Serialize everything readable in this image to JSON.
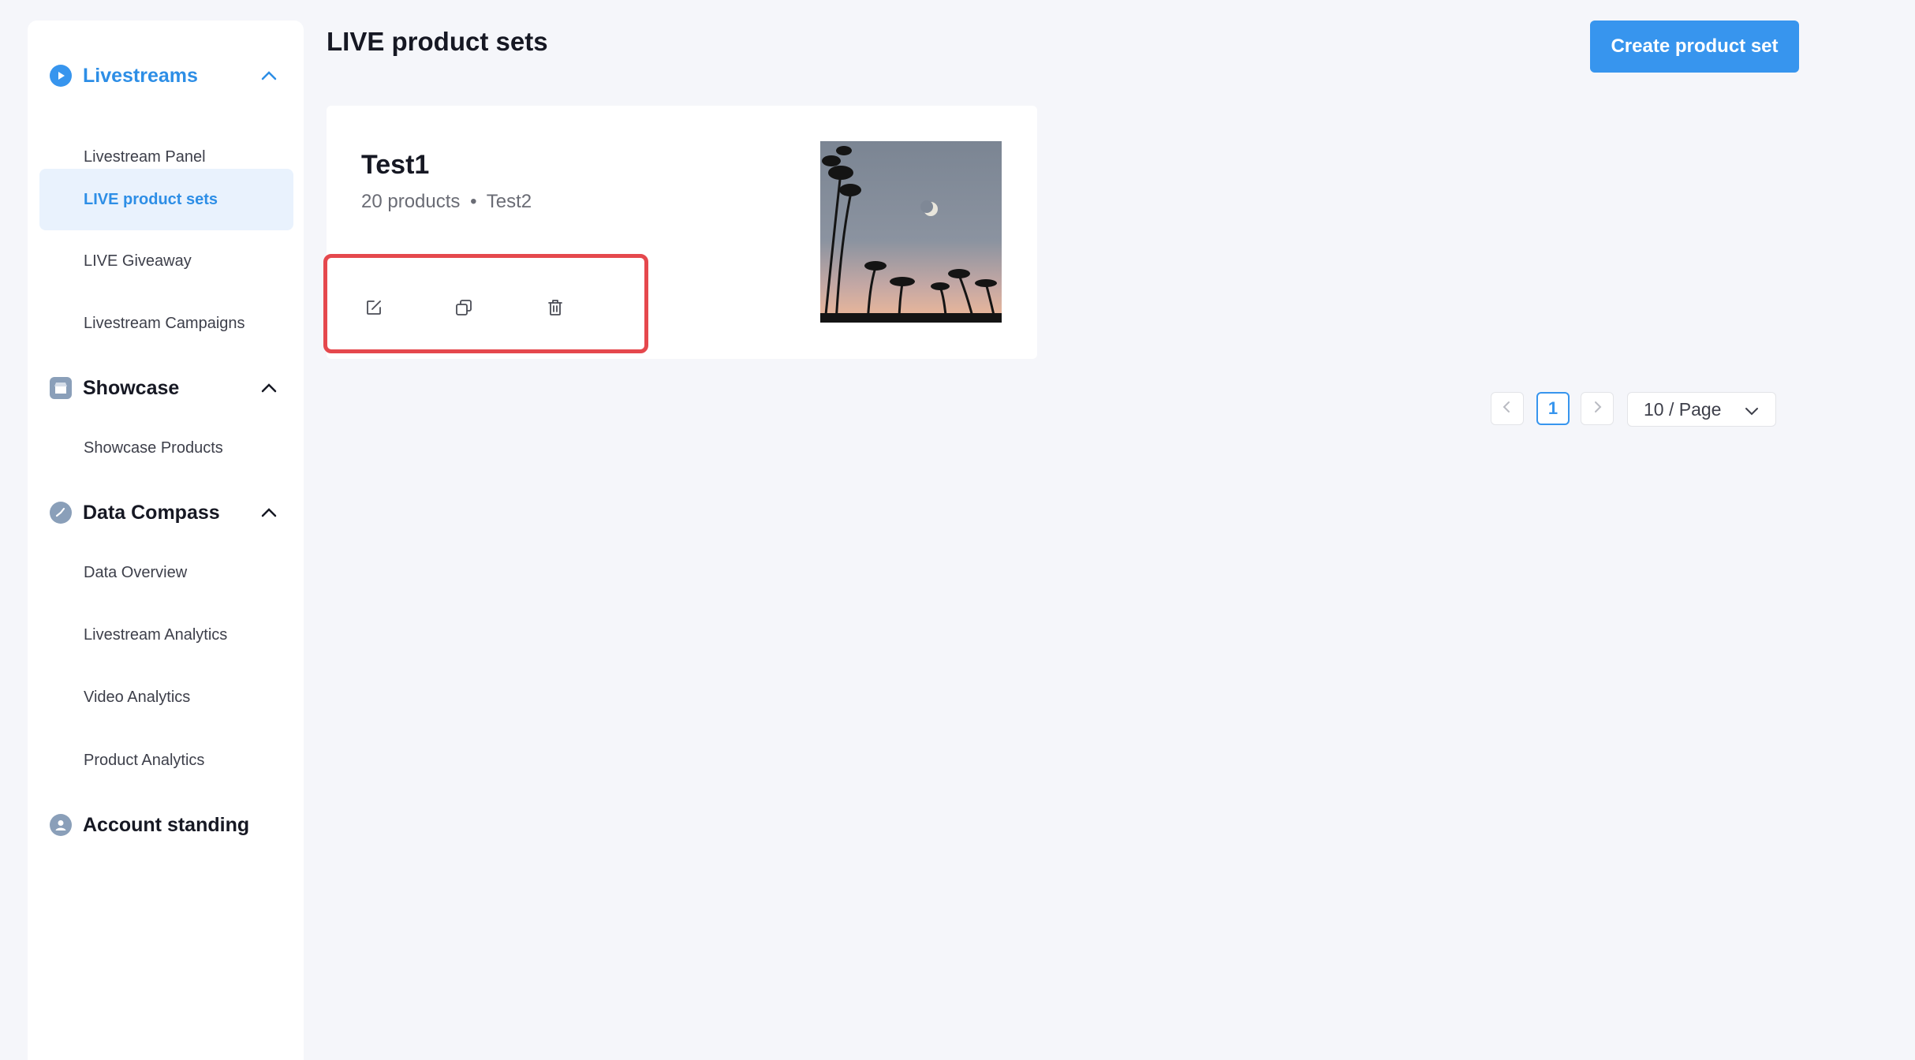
{
  "sidebar": {
    "sections": [
      {
        "title": "Livestreams",
        "icon": "play-circle-icon",
        "items": [
          "Livestream Panel",
          "LIVE product sets",
          "LIVE Giveaway",
          "Livestream Campaigns"
        ]
      },
      {
        "title": "Showcase",
        "icon": "storefront-icon",
        "items": [
          "Showcase Products"
        ]
      },
      {
        "title": "Data Compass",
        "icon": "compass-icon",
        "items": [
          "Data Overview",
          "Livestream Analytics",
          "Video Analytics",
          "Product Analytics"
        ]
      },
      {
        "title": "Account standing",
        "icon": "account-icon",
        "items": []
      }
    ],
    "active_item": "LIVE product sets"
  },
  "header": {
    "title": "LIVE product sets",
    "create_button": "Create product set"
  },
  "product_set": {
    "name": "Test1",
    "product_count": "20 products",
    "separator": "•",
    "creator": "Test2",
    "actions": [
      "edit-icon",
      "duplicate-icon",
      "delete-icon"
    ]
  },
  "pagination": {
    "current_page": "1",
    "page_size": "10 / Page"
  },
  "colors": {
    "accent": "#3795ee",
    "active_bg": "#e9f2fd",
    "highlight_border": "#e5484d"
  }
}
